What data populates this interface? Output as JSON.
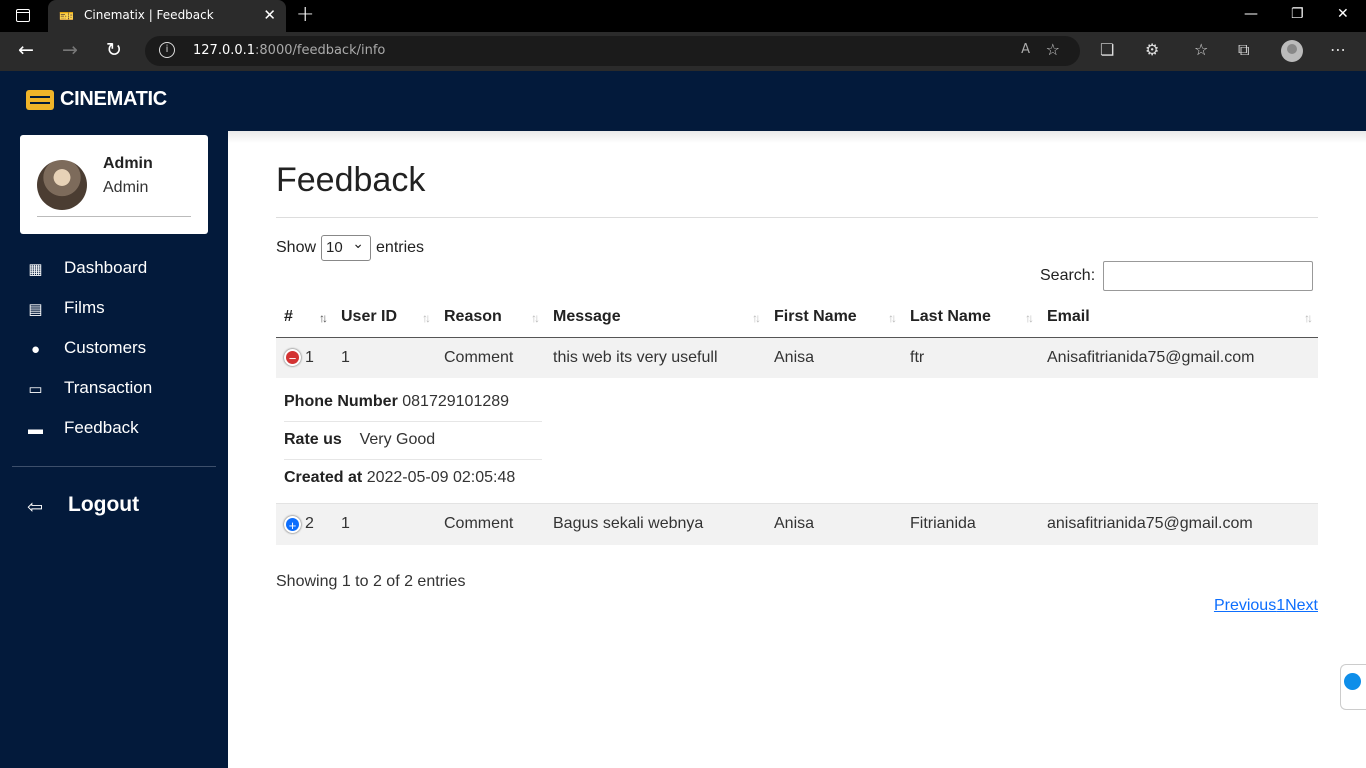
{
  "browser": {
    "tab_title": "Cinematix | Feedback",
    "url_host": "127.0.0.1",
    "url_rest": ":8000/feedback/info"
  },
  "app": {
    "brand": "CINEMATIC",
    "user": {
      "name": "Admin",
      "role": "Admin"
    },
    "menu": [
      {
        "label": "Dashboard",
        "icon": "grid-icon"
      },
      {
        "label": "Films",
        "icon": "film-icon"
      },
      {
        "label": "Customers",
        "icon": "person-icon"
      },
      {
        "label": "Transaction",
        "icon": "card-icon"
      },
      {
        "label": "Feedback",
        "icon": "chat-icon"
      }
    ],
    "logout": "Logout"
  },
  "page": {
    "title": "Feedback",
    "show_label": "Show",
    "entries_value": "10",
    "entries_label": "entries",
    "search_label": "Search:",
    "search_value": "",
    "info": "Showing 1 to 2 of 2 entries",
    "pager": {
      "previous": "Previous",
      "page": "1",
      "next": "Next"
    }
  },
  "table": {
    "headers": [
      "#",
      "User ID",
      "Reason",
      "Message",
      "First Name",
      "Last Name",
      "Email"
    ],
    "rows": [
      {
        "no": "1",
        "user_id": "1",
        "reason": "Comment",
        "message": "this web its very usefull",
        "first": "Anisa",
        "last": "ftr",
        "email": "Anisafitrianida75@gmail.com",
        "expanded": true
      },
      {
        "no": "2",
        "user_id": "1",
        "reason": "Comment",
        "message": "Bagus sekali webnya",
        "first": "Anisa",
        "last": "Fitrianida",
        "email": "anisafitrianida75@gmail.com",
        "expanded": false
      }
    ],
    "detail": {
      "phone_label": "Phone Number",
      "phone": "081729101289",
      "rate_label": "Rate us",
      "rate": "Very Good",
      "created_label": "Created at",
      "created": "2022-05-09 02:05:48"
    }
  },
  "colors": {
    "navy": "#031a3b",
    "link": "#0d6efd",
    "collapse": "#d33333",
    "expand": "#0d6efd"
  }
}
